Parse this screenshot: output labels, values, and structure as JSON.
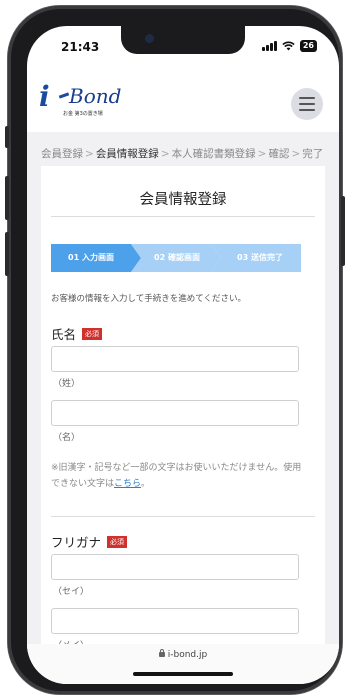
{
  "status": {
    "time": "21:43",
    "battery": "26"
  },
  "logo": {
    "mark": "i",
    "word": "Bond",
    "tagline": "お金 第3の置き場"
  },
  "breadcrumb": [
    {
      "label": "会員登録"
    },
    {
      "label": "会員情報登録"
    },
    {
      "label": "本人確認書類登録"
    },
    {
      "label": "確認"
    },
    {
      "label": "完了"
    }
  ],
  "breadcrumb_sep": ">",
  "page": {
    "title": "会員情報登録"
  },
  "steps": [
    {
      "label": "01 入力画面",
      "active": true
    },
    {
      "label": "02 確認画面",
      "active": false
    },
    {
      "label": "03 送信完了",
      "active": false
    }
  ],
  "intro": "お客様の情報を入力して手続きを進めてください。",
  "name_section": {
    "label": "氏名",
    "required": "必須",
    "sei_value": "",
    "sei_caption": "（姓）",
    "mei_value": "",
    "mei_caption": "（名）"
  },
  "note": {
    "text": "※旧漢字・記号など一部の文字はお使いいただけません。使用できない文字は",
    "link": "こちら",
    "end": "。"
  },
  "kana_section": {
    "label": "フリガナ",
    "required": "必須",
    "sei_value": "",
    "sei_caption": "（セイ）",
    "mei_value": "",
    "mei_caption": "（メイ）"
  },
  "browser": {
    "url": "i-bond.jp"
  },
  "colors": {
    "accent": "#4da1ea",
    "step_inactive": "#a6d0f6",
    "required": "#d0312d",
    "link": "#2d7fd6"
  }
}
